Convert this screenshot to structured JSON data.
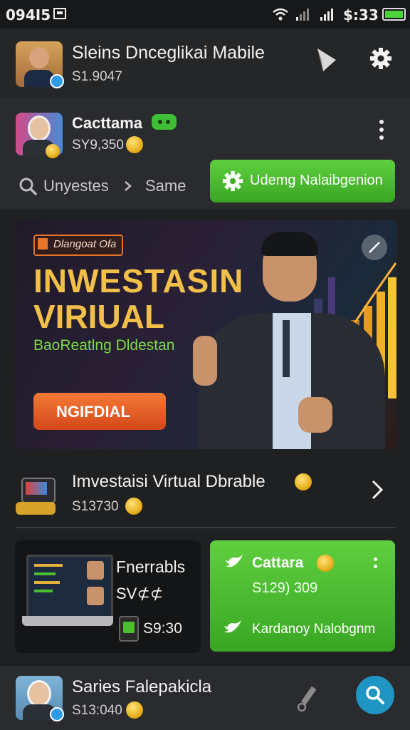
{
  "status_bar": {
    "time": "094I5",
    "clock": "$:33"
  },
  "header": {
    "title": "Sleins Dnceglikai Mabile",
    "balance": "S1.9047"
  },
  "profile": {
    "name": "Cacttama",
    "balance": "SY9,350"
  },
  "breadcrumb": {
    "current": "Unyestes",
    "next": "Same"
  },
  "update_button": {
    "label": "Udemg Nalaibgenion"
  },
  "hero": {
    "tag": "Dlangoat Ofa",
    "title_line1": "INWESTASIN",
    "title_line2": "VIRIUAL",
    "subtitle": "BaoReatlng Dldestan",
    "cta": "NGIFDIAL"
  },
  "investment_row": {
    "title": "Imvestaisi Virtual Dbrable",
    "value": "S13730"
  },
  "card_left": {
    "title": "Fnerrabls",
    "subtitle": "SV⊄⊄",
    "value": "S9:30"
  },
  "card_right": {
    "title": "Cattara",
    "value": "S129) 309",
    "link": "Kardanoy Nalobgnm"
  },
  "bottom_bar": {
    "name": "Saries Falepakicla",
    "balance": "S13:040"
  },
  "colors": {
    "accent_green": "#4cbf2f",
    "cta_orange": "#e2561c",
    "fab_blue": "#1f95c4",
    "gold": "#f0c23a"
  }
}
